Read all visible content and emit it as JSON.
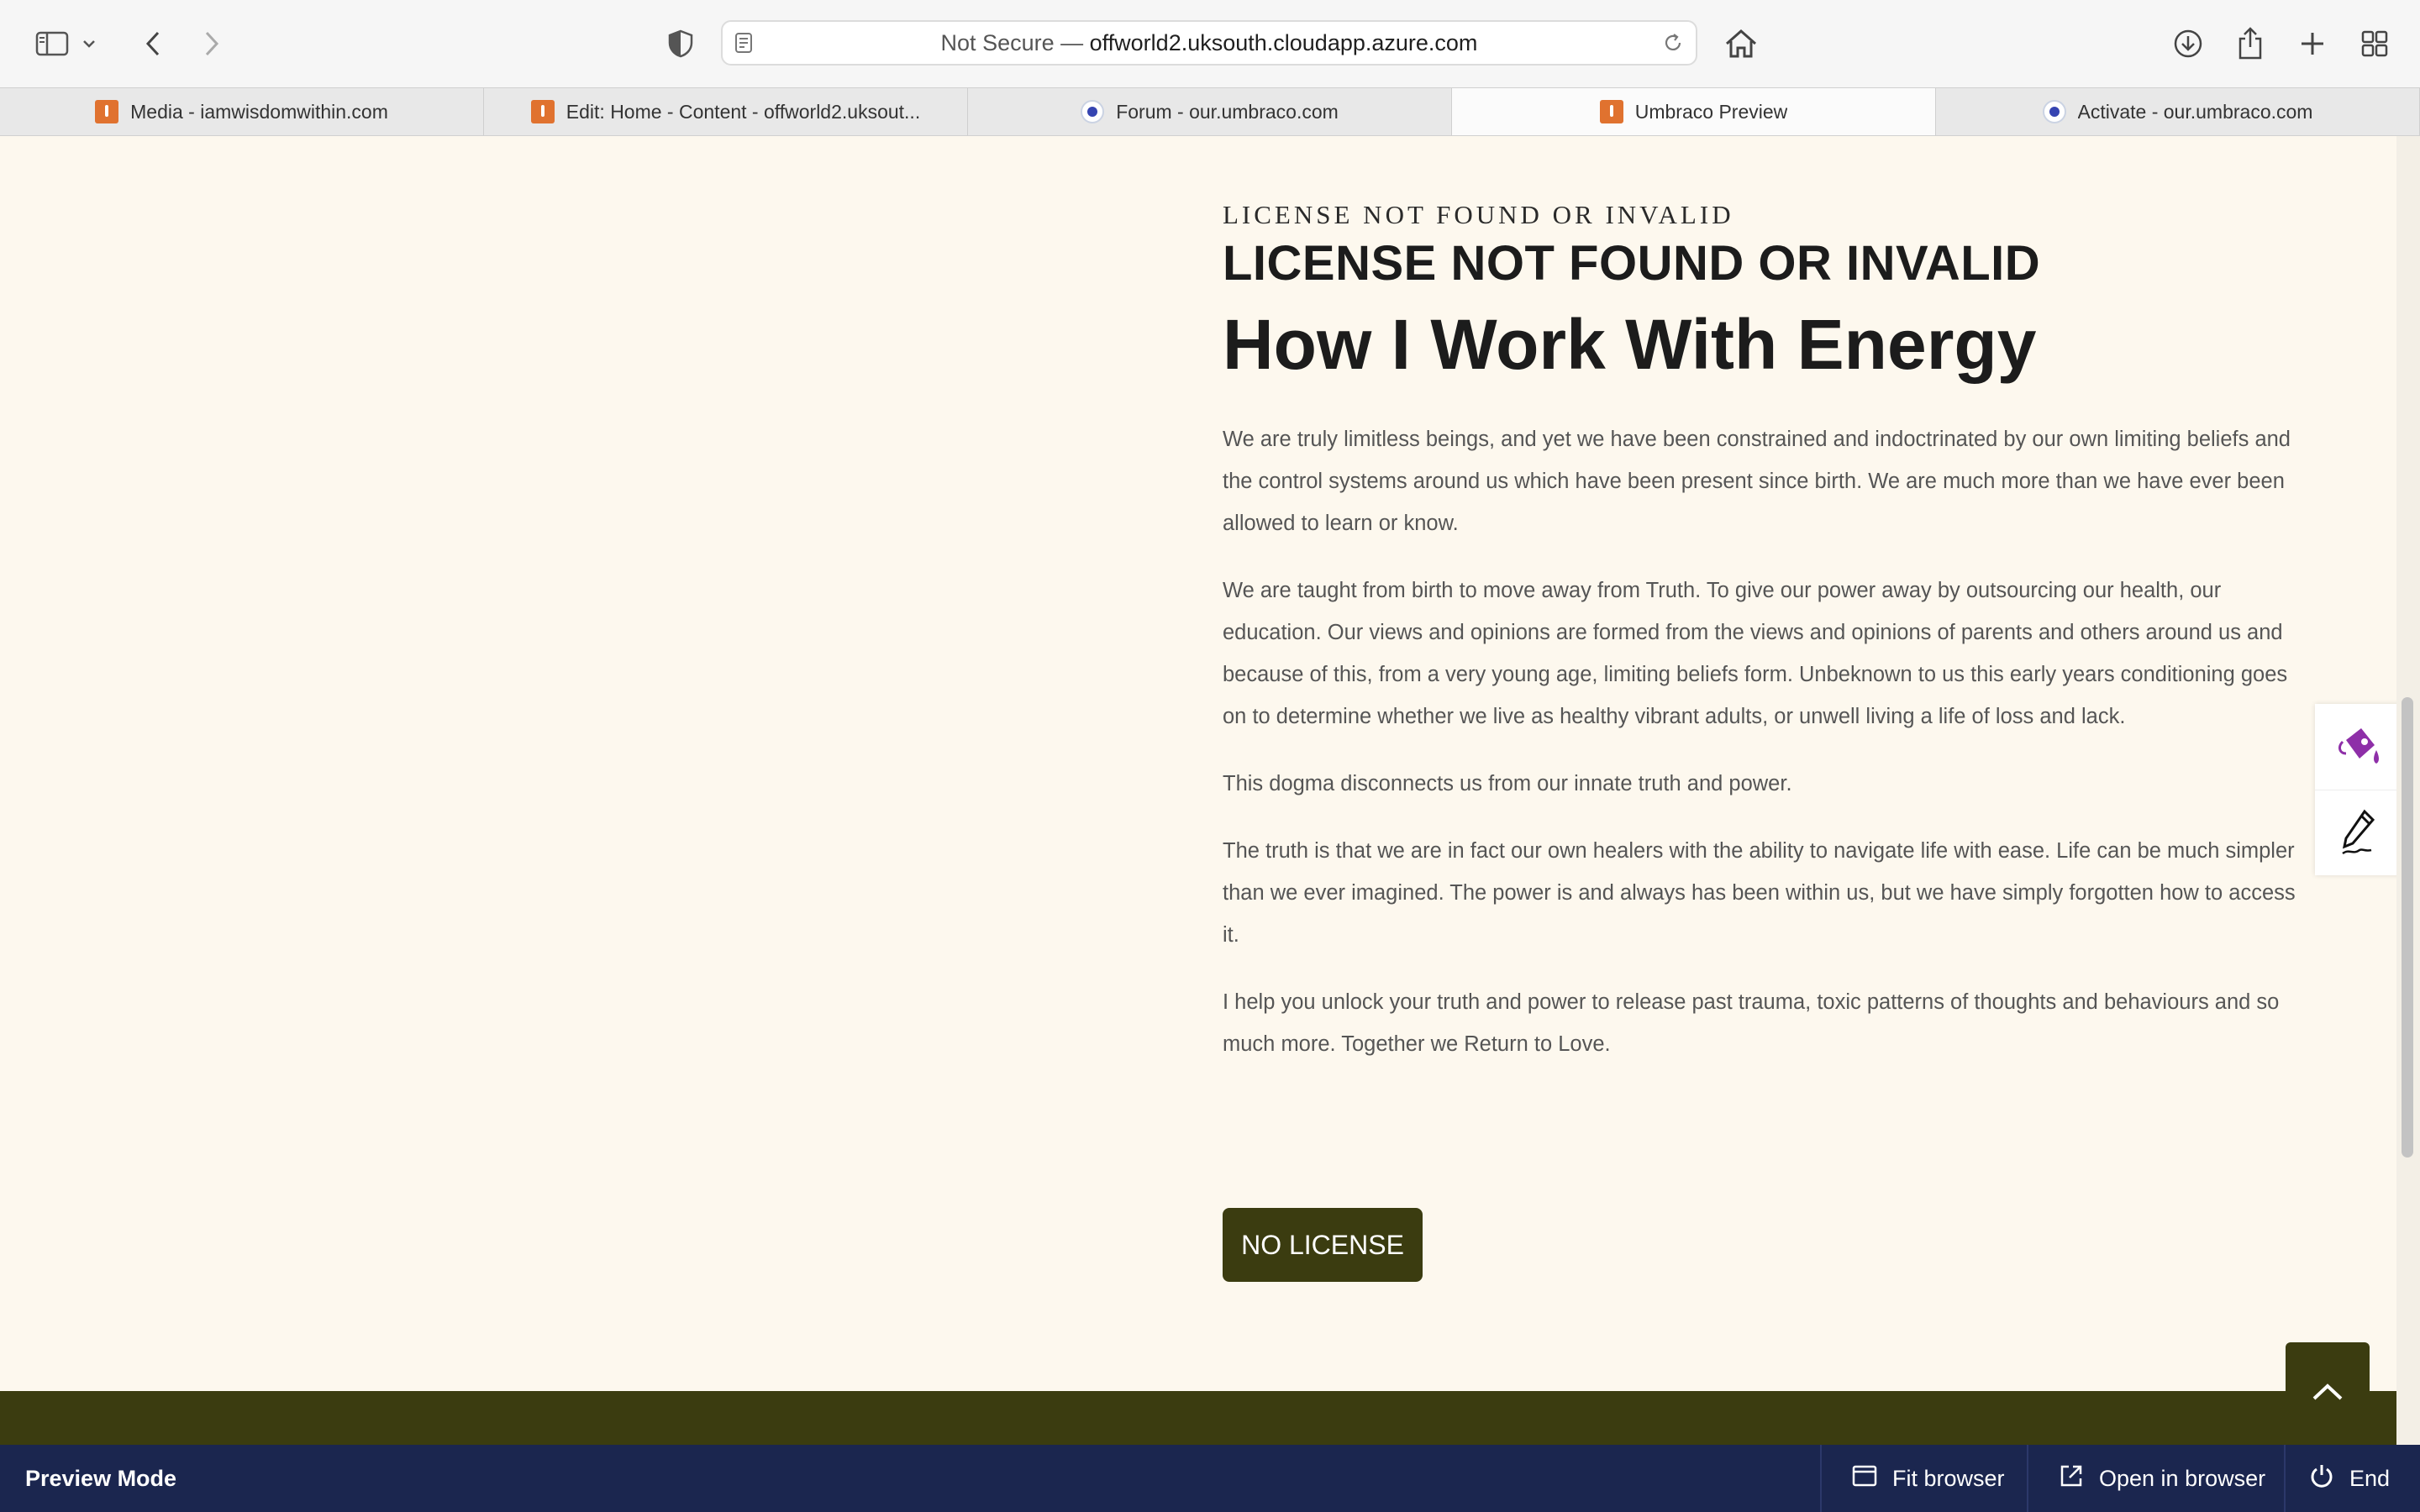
{
  "browser": {
    "url": {
      "security": "Not Secure —",
      "host": "offworld2.uksouth.cloudapp.azure.com"
    },
    "tabs": [
      {
        "label": "Media - iamwisdomwithin.com",
        "favicon": "umbraco-favicon",
        "active": false
      },
      {
        "label": "Edit: Home - Content - offworld2.uksout...",
        "favicon": "umbraco-favicon",
        "active": false
      },
      {
        "label": "Forum - our.umbraco.com",
        "favicon": "our-umbraco-favicon",
        "active": false
      },
      {
        "label": "Umbraco Preview",
        "favicon": "umbraco-favicon",
        "active": true
      },
      {
        "label": "Activate - our.umbraco.com",
        "favicon": "our-umbraco-favicon",
        "active": false
      }
    ],
    "icons": [
      "sidebar-icon",
      "chevron-down-icon",
      "back-icon",
      "forward-icon",
      "shield-icon",
      "reader-icon",
      "reload-icon",
      "home-icon",
      "download-icon",
      "share-icon",
      "new-tab-icon",
      "tab-overview-icon"
    ]
  },
  "page": {
    "kicker": "LICENSE NOT FOUND OR INVALID",
    "subtitle": "LICENSE NOT FOUND OR INVALID",
    "title": "How I Work With Energy",
    "paragraphs": [
      "We are truly limitless beings, and yet we have been constrained and indoctrinated by our own limiting beliefs and the control systems around us which have been present since birth. We are much more than we have ever been allowed to learn or know.",
      "We are taught from birth to move away from Truth. To give our power away by outsourcing our health, our education. Our views and opinions are formed from the views and opinions of parents and others around us and because of this, from a very young age, limiting beliefs form. Unbeknown to us this early years conditioning goes on to determine whether we live as healthy vibrant adults, or unwell living a life of loss and lack.",
      "This dogma disconnects us from our innate truth and power.",
      "The truth is that we are in fact our own healers with the ability to navigate life with ease. Life can be much simpler than we ever imagined. The power is and always has been within us, but we have simply forgotten how to access it.",
      "I help you unlock your truth and power to release past trauma, toxic patterns of thoughts and behaviours and so much more. Together we Return to Love."
    ],
    "cta_label": "NO LICENSE",
    "side_tools": [
      "paint-bucket-icon",
      "pen-icon"
    ],
    "scroll_top_icon": "chevron-up-icon"
  },
  "preview": {
    "title": "Preview Mode",
    "fit_browser": "Fit browser",
    "open_in_browser": "Open in browser",
    "end": "End"
  },
  "colors": {
    "page_bg": "#fdf8ee",
    "olive": "#3b3c10",
    "preview_bar": "#1b264f",
    "accent_purple": "#8e2fa8",
    "favicon_orange": "#e0722f"
  }
}
